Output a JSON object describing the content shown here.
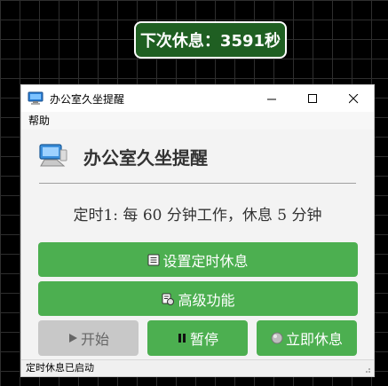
{
  "countdown": {
    "text": "下次休息：3591秒"
  },
  "window": {
    "title": "办公室久坐提醒",
    "menu": [
      "帮助"
    ]
  },
  "app": {
    "heading": "办公室久坐提醒",
    "schedule_text": "定时1: 每 60 分钟工作，休息 5 分钟"
  },
  "buttons": {
    "set_timer": "设置定时休息",
    "advanced": "高级功能",
    "start": "开始",
    "pause": "暂停",
    "rest_now": "立即休息"
  },
  "status": {
    "text": "定时休息已启动"
  },
  "colors": {
    "accent": "#4caf50",
    "countdown_bg": "#1f5f22",
    "disabled": "#c8c8c8"
  },
  "icons": [
    "computer-icon",
    "notepad-icon",
    "wrench-icon",
    "play-icon",
    "pause-icon",
    "rest-icon"
  ]
}
